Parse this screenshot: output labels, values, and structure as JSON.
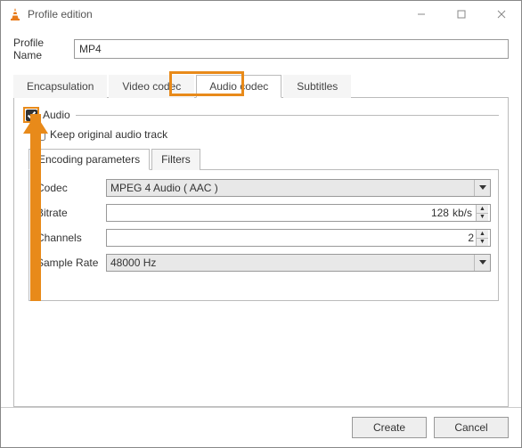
{
  "window": {
    "title": "Profile edition"
  },
  "profile": {
    "label": "Profile Name",
    "value": "MP4"
  },
  "mainTabs": {
    "encapsulation": "Encapsulation",
    "videoCodec": "Video codec",
    "audioCodec": "Audio codec",
    "subtitles": "Subtitles"
  },
  "audio": {
    "legendLabel": "Audio",
    "checked": true,
    "keepOriginal": {
      "label": "Keep original audio track",
      "checked": false
    }
  },
  "subTabs": {
    "encodingParameters": "Encoding parameters",
    "filters": "Filters"
  },
  "params": {
    "codec": {
      "label": "Codec",
      "value": "MPEG 4 Audio ( AAC )"
    },
    "bitrate": {
      "label": "Bitrate",
      "value": "128",
      "unit": "kb/s"
    },
    "channels": {
      "label": "Channels",
      "value": "2"
    },
    "sampleRate": {
      "label": "Sample Rate",
      "value": "48000 Hz"
    }
  },
  "buttons": {
    "create": "Create",
    "cancel": "Cancel"
  }
}
